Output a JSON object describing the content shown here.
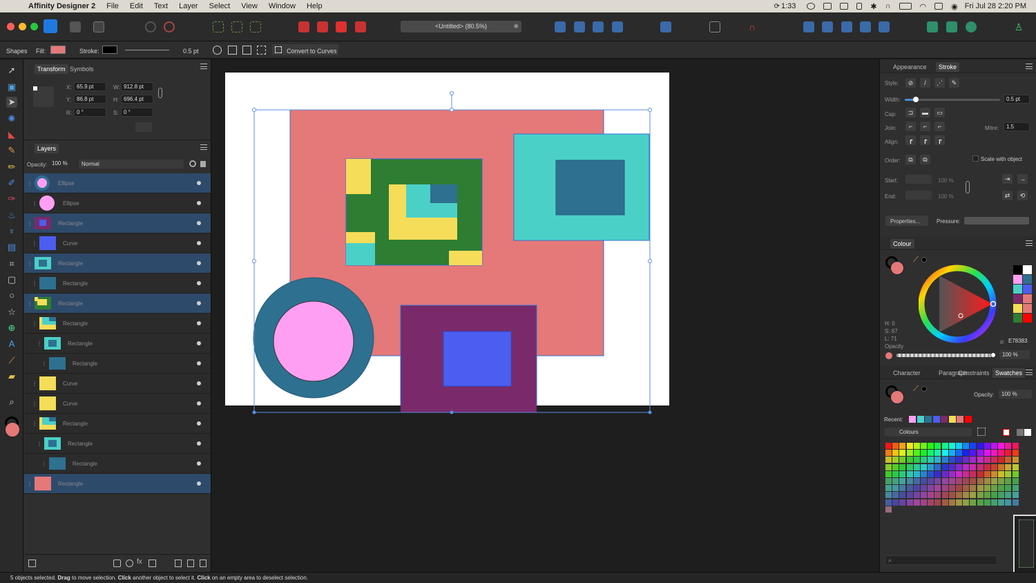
{
  "menubar": {
    "app_name": "Affinity Designer 2",
    "items": [
      "File",
      "Edit",
      "Text",
      "Layer",
      "Select",
      "View",
      "Window",
      "Help"
    ],
    "clock_timer": "1:33",
    "datetime": "Fri Jul 28  2:20 PM"
  },
  "toolbar": {
    "document_title": "<Untitled> (80.5%)",
    "close_doc_glyph": "✱"
  },
  "context": {
    "tool_name": "Shapes",
    "fill_label": "Fill:",
    "fill_color": "#e57878",
    "stroke_label": "Stroke:",
    "stroke_color": "#000000",
    "stroke_width": "0.5 pt",
    "convert_label": "Convert to Curves"
  },
  "transform": {
    "tab_transform": "Transform",
    "tab_symbols": "Symbols",
    "x_label": "X:",
    "x": "65.9 pt",
    "y_label": "Y:",
    "y": "86.8 pt",
    "w_label": "W:",
    "w": "912.8 pt",
    "h_label": "H:",
    "h": "696.4 pt",
    "r_label": "R:",
    "r": "0 °",
    "s_label": "S:",
    "s": "0 °"
  },
  "layers": {
    "title": "Layers",
    "opacity_label": "Opacity:",
    "opacity": "100 %",
    "blend_mode": "Normal",
    "rows": [
      {
        "name": "Ellipse",
        "sel": true,
        "indent": 0,
        "thumb": "ellipse-ring"
      },
      {
        "name": "Ellipse",
        "sel": false,
        "indent": 1,
        "thumb": "ellipse-pink"
      },
      {
        "name": "Rectangle",
        "sel": true,
        "indent": 0,
        "thumb": "rect-purple"
      },
      {
        "name": "Curve",
        "sel": false,
        "indent": 1,
        "thumb": "rect-blue"
      },
      {
        "name": "Rectangle",
        "sel": true,
        "indent": 0,
        "thumb": "rect-teal"
      },
      {
        "name": "Rectangle",
        "sel": false,
        "indent": 1,
        "thumb": "rect-darkteal"
      },
      {
        "name": "Rectangle",
        "sel": true,
        "indent": 0,
        "thumb": "rect-green"
      },
      {
        "name": "Rectangle",
        "sel": false,
        "indent": 1,
        "thumb": "rect-teal-yellow"
      },
      {
        "name": "Rectangle",
        "sel": false,
        "indent": 2,
        "thumb": "rect-teal"
      },
      {
        "name": "Rectangle",
        "sel": false,
        "indent": 3,
        "thumb": "rect-darkteal"
      },
      {
        "name": "Curve",
        "sel": false,
        "indent": 1,
        "thumb": "rect-yellow"
      },
      {
        "name": "Curve",
        "sel": false,
        "indent": 1,
        "thumb": "rect-yellow"
      },
      {
        "name": "Rectangle",
        "sel": false,
        "indent": 1,
        "thumb": "rect-teal-yellow"
      },
      {
        "name": "Rectangle",
        "sel": false,
        "indent": 2,
        "thumb": "rect-teal"
      },
      {
        "name": "Rectangle",
        "sel": false,
        "indent": 3,
        "thumb": "rect-darkteal"
      },
      {
        "name": "Rectangle",
        "sel": true,
        "indent": 0,
        "thumb": "rect-salmon"
      }
    ]
  },
  "stroke_panel": {
    "tab_appearance": "Appearance",
    "tab_stroke": "Stroke",
    "style_label": "Style:",
    "width_label": "Width:",
    "width": "0.5 pt",
    "cap_label": "Cap:",
    "join_label": "Join:",
    "mitre_label": "Mitre:",
    "mitre": "1.5",
    "align_label": "Align:",
    "order_label": "Order:",
    "scale_label": "Scale with object",
    "start_label": "Start:",
    "start_pct": "100 %",
    "end_label": "End:",
    "end_pct": "100 %",
    "properties_label": "Properties...",
    "pressure_label": "Pressure:"
  },
  "colour_panel": {
    "title": "Colour",
    "h": "H: 0",
    "s": "S: 67",
    "l": "L: 71",
    "opacity_label": "Opacity",
    "hex_prefix": "#:",
    "hex": "E78383",
    "opacity": "100 %",
    "current_color": "#e57878"
  },
  "swatches_panel": {
    "tab_character": "Character",
    "tab_paragraph": "Paragraph",
    "tab_constraints": "Constraints",
    "tab_swatches": "Swatches",
    "opacity_label": "Opacity:",
    "opacity": "100 %",
    "recent_label": "Recent:",
    "palette_name": "Colours",
    "recent_colors": [
      "#ff9ff3",
      "#4bd0c8",
      "#2e7090",
      "#4b5ef0",
      "#7a2a6a",
      "#f5dd5a",
      "#e57878",
      "#ff0000"
    ]
  },
  "status": {
    "count": "5 objects selected.",
    "drag": "Drag",
    "drag_text": "to move selection.",
    "click1": "Click",
    "click1_text": "another object to select it.",
    "click2": "Click",
    "click2_text": "on an empty area to deselect selection."
  }
}
